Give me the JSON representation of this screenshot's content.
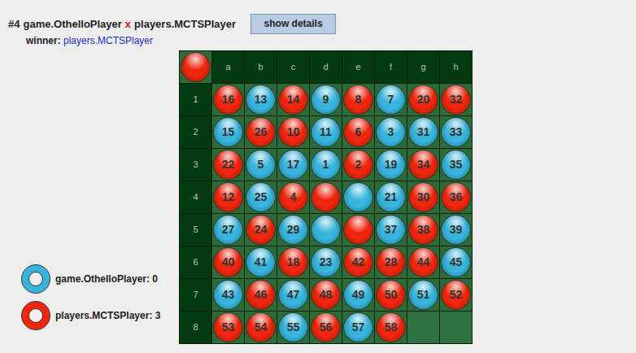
{
  "header": {
    "game": "#4",
    "player1": "game.OthelloPlayer",
    "separator": "x",
    "player2": "players.MCTSPlayer",
    "button": "show details",
    "winner_label": "winner:",
    "winner": "players.MCTSPlayer"
  },
  "board": {
    "turn": {
      "color": "#f0260e"
    },
    "columns": [
      "a",
      "b",
      "c",
      "d",
      "e",
      "f",
      "g",
      "h"
    ],
    "rows": [
      {
        "label": "1",
        "cells": [
          {
            "kind": "disc",
            "color": "#f0260e",
            "move": "16"
          },
          {
            "kind": "disc",
            "color": "#38b4dc",
            "move": "13"
          },
          {
            "kind": "disc",
            "color": "#f0260e",
            "move": "14"
          },
          {
            "kind": "disc",
            "color": "#38b4dc",
            "move": "9"
          },
          {
            "kind": "disc",
            "color": "#f0260e",
            "move": "8"
          },
          {
            "kind": "disc",
            "color": "#38b4dc",
            "move": "7"
          },
          {
            "kind": "disc",
            "color": "#f0260e",
            "move": "20"
          },
          {
            "kind": "disc",
            "color": "#f0260e",
            "move": "32"
          }
        ]
      },
      {
        "label": "2",
        "cells": [
          {
            "kind": "disc",
            "color": "#38b4dc",
            "move": "15"
          },
          {
            "kind": "disc",
            "color": "#f0260e",
            "move": "26"
          },
          {
            "kind": "disc",
            "color": "#f0260e",
            "move": "10"
          },
          {
            "kind": "disc",
            "color": "#38b4dc",
            "move": "11"
          },
          {
            "kind": "disc",
            "color": "#f0260e",
            "move": "6"
          },
          {
            "kind": "disc",
            "color": "#38b4dc",
            "move": "3"
          },
          {
            "kind": "disc",
            "color": "#38b4dc",
            "move": "31"
          },
          {
            "kind": "disc",
            "color": "#38b4dc",
            "move": "33"
          }
        ]
      },
      {
        "label": "3",
        "cells": [
          {
            "kind": "disc",
            "color": "#f0260e",
            "move": "22"
          },
          {
            "kind": "disc",
            "color": "#38b4dc",
            "move": "5"
          },
          {
            "kind": "disc",
            "color": "#38b4dc",
            "move": "17"
          },
          {
            "kind": "disc",
            "color": "#38b4dc",
            "move": "1"
          },
          {
            "kind": "disc",
            "color": "#f0260e",
            "move": "2"
          },
          {
            "kind": "disc",
            "color": "#38b4dc",
            "move": "19"
          },
          {
            "kind": "disc",
            "color": "#f0260e",
            "move": "34"
          },
          {
            "kind": "disc",
            "color": "#38b4dc",
            "move": "35"
          }
        ]
      },
      {
        "label": "4",
        "cells": [
          {
            "kind": "disc",
            "color": "#f0260e",
            "move": "12"
          },
          {
            "kind": "disc",
            "color": "#38b4dc",
            "move": "25"
          },
          {
            "kind": "disc",
            "color": "#f0260e",
            "move": "4"
          },
          {
            "kind": "disc",
            "color": "#f0260e"
          },
          {
            "kind": "disc",
            "color": "#38b4dc"
          },
          {
            "kind": "disc",
            "color": "#38b4dc",
            "move": "21"
          },
          {
            "kind": "disc",
            "color": "#f0260e",
            "move": "30"
          },
          {
            "kind": "disc",
            "color": "#f0260e",
            "move": "36"
          }
        ]
      },
      {
        "label": "5",
        "cells": [
          {
            "kind": "disc",
            "color": "#38b4dc",
            "move": "27"
          },
          {
            "kind": "disc",
            "color": "#f0260e",
            "move": "24"
          },
          {
            "kind": "disc",
            "color": "#38b4dc",
            "move": "29"
          },
          {
            "kind": "disc",
            "color": "#38b4dc"
          },
          {
            "kind": "disc",
            "color": "#f0260e"
          },
          {
            "kind": "disc",
            "color": "#38b4dc",
            "move": "37"
          },
          {
            "kind": "disc",
            "color": "#f0260e",
            "move": "38"
          },
          {
            "kind": "disc",
            "color": "#38b4dc",
            "move": "39"
          }
        ]
      },
      {
        "label": "6",
        "cells": [
          {
            "kind": "disc",
            "color": "#f0260e",
            "move": "40"
          },
          {
            "kind": "disc",
            "color": "#38b4dc",
            "move": "41"
          },
          {
            "kind": "disc",
            "color": "#f0260e",
            "move": "18"
          },
          {
            "kind": "disc",
            "color": "#38b4dc",
            "move": "23"
          },
          {
            "kind": "disc",
            "color": "#f0260e",
            "move": "42"
          },
          {
            "kind": "disc",
            "color": "#f0260e",
            "move": "28"
          },
          {
            "kind": "disc",
            "color": "#f0260e",
            "move": "44"
          },
          {
            "kind": "disc",
            "color": "#38b4dc",
            "move": "45"
          }
        ]
      },
      {
        "label": "7",
        "cells": [
          {
            "kind": "disc",
            "color": "#38b4dc",
            "move": "43"
          },
          {
            "kind": "disc",
            "color": "#f0260e",
            "move": "46"
          },
          {
            "kind": "disc",
            "color": "#38b4dc",
            "move": "47"
          },
          {
            "kind": "disc",
            "color": "#f0260e",
            "move": "48"
          },
          {
            "kind": "disc",
            "color": "#38b4dc",
            "move": "49"
          },
          {
            "kind": "disc",
            "color": "#f0260e",
            "move": "50"
          },
          {
            "kind": "disc",
            "color": "#38b4dc",
            "move": "51"
          },
          {
            "kind": "disc",
            "color": "#f0260e",
            "move": "52"
          }
        ]
      },
      {
        "label": "8",
        "cells": [
          {
            "kind": "disc",
            "color": "#f0260e",
            "move": "53"
          },
          {
            "kind": "disc",
            "color": "#f0260e",
            "move": "54"
          },
          {
            "kind": "disc",
            "color": "#38b4dc",
            "move": "55"
          },
          {
            "kind": "disc",
            "color": "#f0260e",
            "move": "56"
          },
          {
            "kind": "disc",
            "color": "#38b4dc",
            "move": "57"
          },
          {
            "kind": "disc",
            "color": "#f0260e",
            "move": "58"
          },
          {
            "kind": "empty"
          },
          {
            "kind": "empty"
          }
        ]
      }
    ]
  },
  "players": [
    {
      "name": "game.OthelloPlayer: 0",
      "color": "#38b4dc"
    },
    {
      "name": "players.MCTSPlayer: 3",
      "color": "#f0260e"
    }
  ]
}
